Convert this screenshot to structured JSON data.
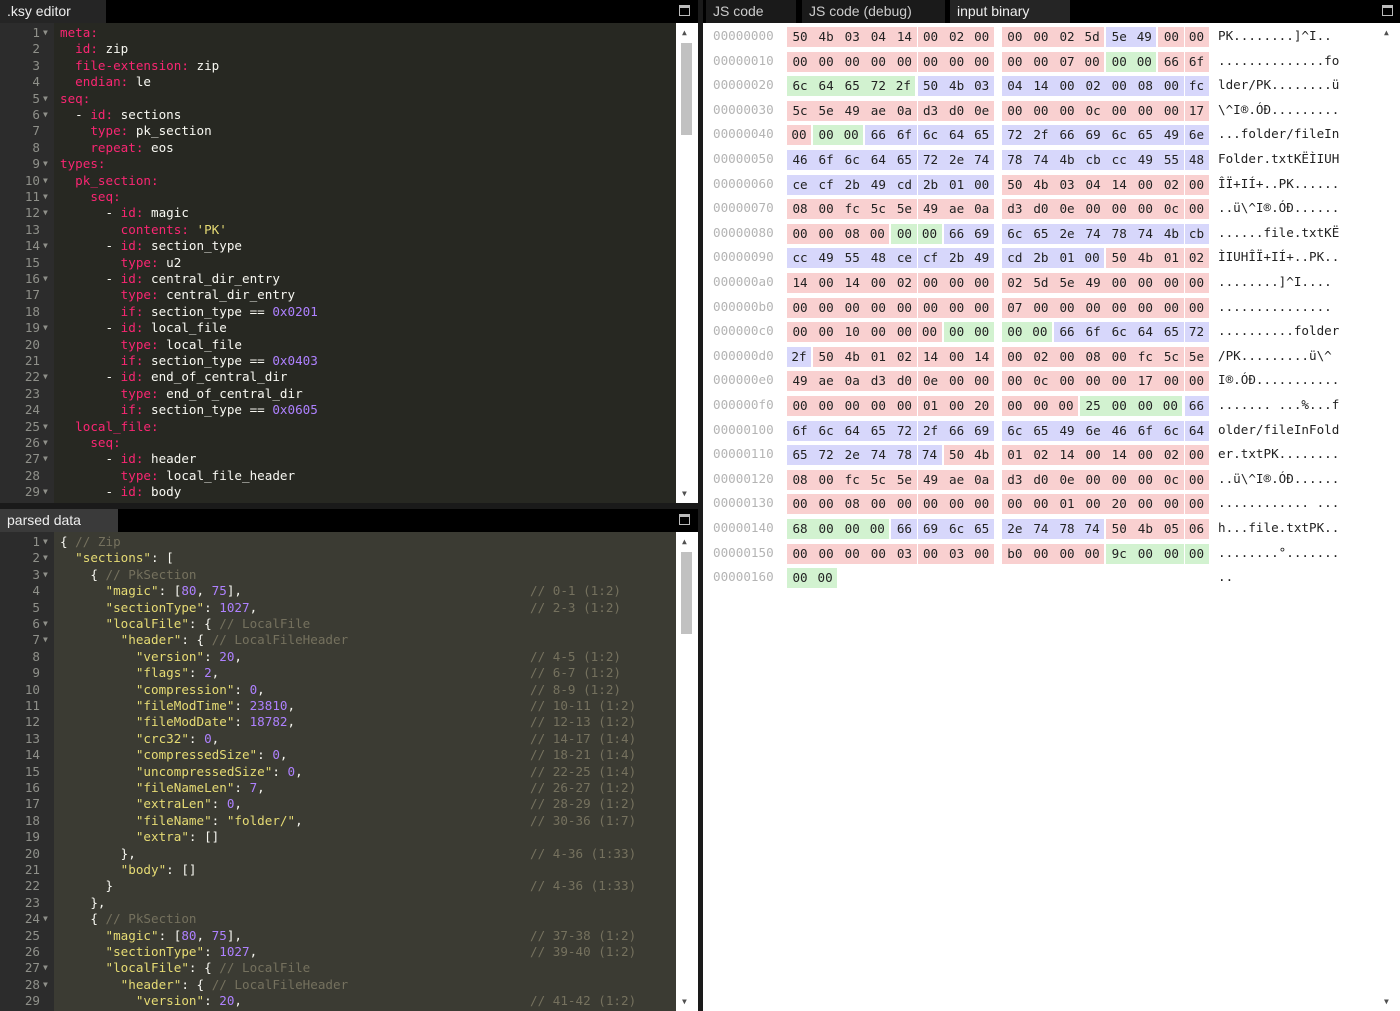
{
  "ksy_editor": {
    "tab_label": ".ksy editor",
    "lines": [
      [
        {
          "t": "meta:",
          "c": "k"
        }
      ],
      [
        {
          "t": "  "
        },
        {
          "t": "id:",
          "c": "k"
        },
        {
          "t": " zip"
        }
      ],
      [
        {
          "t": "  "
        },
        {
          "t": "file-extension:",
          "c": "k"
        },
        {
          "t": " zip"
        }
      ],
      [
        {
          "t": "  "
        },
        {
          "t": "endian:",
          "c": "k"
        },
        {
          "t": " le"
        }
      ],
      [
        {
          "t": "seq:",
          "c": "k"
        }
      ],
      [
        {
          "t": "  - "
        },
        {
          "t": "id:",
          "c": "k"
        },
        {
          "t": " sections"
        }
      ],
      [
        {
          "t": "    "
        },
        {
          "t": "type:",
          "c": "k"
        },
        {
          "t": " pk_section"
        }
      ],
      [
        {
          "t": "    "
        },
        {
          "t": "repeat:",
          "c": "k"
        },
        {
          "t": " eos"
        }
      ],
      [
        {
          "t": "types:",
          "c": "k"
        }
      ],
      [
        {
          "t": "  "
        },
        {
          "t": "pk_section:",
          "c": "k"
        }
      ],
      [
        {
          "t": "    "
        },
        {
          "t": "seq:",
          "c": "k"
        }
      ],
      [
        {
          "t": "      - "
        },
        {
          "t": "id:",
          "c": "k"
        },
        {
          "t": " magic"
        }
      ],
      [
        {
          "t": "        "
        },
        {
          "t": "contents:",
          "c": "k"
        },
        {
          "t": " 'PK'",
          "c": "s"
        }
      ],
      [
        {
          "t": "      - "
        },
        {
          "t": "id:",
          "c": "k"
        },
        {
          "t": " section_type"
        }
      ],
      [
        {
          "t": "        "
        },
        {
          "t": "type:",
          "c": "k"
        },
        {
          "t": " u2"
        }
      ],
      [
        {
          "t": "      - "
        },
        {
          "t": "id:",
          "c": "k"
        },
        {
          "t": " central_dir_entry"
        }
      ],
      [
        {
          "t": "        "
        },
        {
          "t": "type:",
          "c": "k"
        },
        {
          "t": " central_dir_entry"
        }
      ],
      [
        {
          "t": "        "
        },
        {
          "t": "if:",
          "c": "k"
        },
        {
          "t": " section_type == "
        },
        {
          "t": "0x0201",
          "c": "n"
        }
      ],
      [
        {
          "t": "      - "
        },
        {
          "t": "id:",
          "c": "k"
        },
        {
          "t": " local_file"
        }
      ],
      [
        {
          "t": "        "
        },
        {
          "t": "type:",
          "c": "k"
        },
        {
          "t": " local_file"
        }
      ],
      [
        {
          "t": "        "
        },
        {
          "t": "if:",
          "c": "k"
        },
        {
          "t": " section_type == "
        },
        {
          "t": "0x0403",
          "c": "n"
        }
      ],
      [
        {
          "t": "      - "
        },
        {
          "t": "id:",
          "c": "k"
        },
        {
          "t": " end_of_central_dir"
        }
      ],
      [
        {
          "t": "        "
        },
        {
          "t": "type:",
          "c": "k"
        },
        {
          "t": " end_of_central_dir"
        }
      ],
      [
        {
          "t": "        "
        },
        {
          "t": "if:",
          "c": "k"
        },
        {
          "t": " section_type == "
        },
        {
          "t": "0x0605",
          "c": "n"
        }
      ],
      [
        {
          "t": "  "
        },
        {
          "t": "local_file:",
          "c": "k"
        }
      ],
      [
        {
          "t": "    "
        },
        {
          "t": "seq:",
          "c": "k"
        }
      ],
      [
        {
          "t": "      - "
        },
        {
          "t": "id:",
          "c": "k"
        },
        {
          "t": " header"
        }
      ],
      [
        {
          "t": "        "
        },
        {
          "t": "type:",
          "c": "k"
        },
        {
          "t": " local_file_header"
        }
      ],
      [
        {
          "t": "      - "
        },
        {
          "t": "id:",
          "c": "k"
        },
        {
          "t": " body"
        }
      ]
    ],
    "fold_lines": [
      1,
      5,
      6,
      9,
      10,
      11,
      12,
      14,
      16,
      19,
      22,
      25,
      26,
      27,
      29
    ]
  },
  "parsed_data": {
    "tab_label": "parsed data",
    "lines": [
      [
        {
          "t": "{ "
        },
        {
          "t": "// Zip",
          "c": "c"
        }
      ],
      [
        {
          "t": "  "
        },
        {
          "t": "\"sections\"",
          "c": "s"
        },
        {
          "t": ": ["
        }
      ],
      [
        {
          "t": "    { "
        },
        {
          "t": "// PkSection",
          "c": "c"
        }
      ],
      [
        {
          "t": "      "
        },
        {
          "t": "\"magic\"",
          "c": "s"
        },
        {
          "t": ": ["
        },
        {
          "t": "80",
          "c": "n"
        },
        {
          "t": ", "
        },
        {
          "t": "75",
          "c": "n"
        },
        {
          "t": "],"
        }
      ],
      [
        {
          "t": "      "
        },
        {
          "t": "\"sectionType\"",
          "c": "s"
        },
        {
          "t": ": "
        },
        {
          "t": "1027",
          "c": "n"
        },
        {
          "t": ","
        }
      ],
      [
        {
          "t": "      "
        },
        {
          "t": "\"localFile\"",
          "c": "s"
        },
        {
          "t": ": { "
        },
        {
          "t": "// LocalFile",
          "c": "c"
        }
      ],
      [
        {
          "t": "        "
        },
        {
          "t": "\"header\"",
          "c": "s"
        },
        {
          "t": ": { "
        },
        {
          "t": "// LocalFileHeader",
          "c": "c"
        }
      ],
      [
        {
          "t": "          "
        },
        {
          "t": "\"version\"",
          "c": "s"
        },
        {
          "t": ": "
        },
        {
          "t": "20",
          "c": "n"
        },
        {
          "t": ","
        }
      ],
      [
        {
          "t": "          "
        },
        {
          "t": "\"flags\"",
          "c": "s"
        },
        {
          "t": ": "
        },
        {
          "t": "2",
          "c": "n"
        },
        {
          "t": ","
        }
      ],
      [
        {
          "t": "          "
        },
        {
          "t": "\"compression\"",
          "c": "s"
        },
        {
          "t": ": "
        },
        {
          "t": "0",
          "c": "n"
        },
        {
          "t": ","
        }
      ],
      [
        {
          "t": "          "
        },
        {
          "t": "\"fileModTime\"",
          "c": "s"
        },
        {
          "t": ": "
        },
        {
          "t": "23810",
          "c": "n"
        },
        {
          "t": ","
        }
      ],
      [
        {
          "t": "          "
        },
        {
          "t": "\"fileModDate\"",
          "c": "s"
        },
        {
          "t": ": "
        },
        {
          "t": "18782",
          "c": "n"
        },
        {
          "t": ","
        }
      ],
      [
        {
          "t": "          "
        },
        {
          "t": "\"crc32\"",
          "c": "s"
        },
        {
          "t": ": "
        },
        {
          "t": "0",
          "c": "n"
        },
        {
          "t": ","
        }
      ],
      [
        {
          "t": "          "
        },
        {
          "t": "\"compressedSize\"",
          "c": "s"
        },
        {
          "t": ": "
        },
        {
          "t": "0",
          "c": "n"
        },
        {
          "t": ","
        }
      ],
      [
        {
          "t": "          "
        },
        {
          "t": "\"uncompressedSize\"",
          "c": "s"
        },
        {
          "t": ": "
        },
        {
          "t": "0",
          "c": "n"
        },
        {
          "t": ","
        }
      ],
      [
        {
          "t": "          "
        },
        {
          "t": "\"fileNameLen\"",
          "c": "s"
        },
        {
          "t": ": "
        },
        {
          "t": "7",
          "c": "n"
        },
        {
          "t": ","
        }
      ],
      [
        {
          "t": "          "
        },
        {
          "t": "\"extraLen\"",
          "c": "s"
        },
        {
          "t": ": "
        },
        {
          "t": "0",
          "c": "n"
        },
        {
          "t": ","
        }
      ],
      [
        {
          "t": "          "
        },
        {
          "t": "\"fileName\"",
          "c": "s"
        },
        {
          "t": ": "
        },
        {
          "t": "\"folder/\"",
          "c": "s"
        },
        {
          "t": ","
        }
      ],
      [
        {
          "t": "          "
        },
        {
          "t": "\"extra\"",
          "c": "s"
        },
        {
          "t": ": []"
        }
      ],
      [
        {
          "t": "        },"
        }
      ],
      [
        {
          "t": "        "
        },
        {
          "t": "\"body\"",
          "c": "s"
        },
        {
          "t": ": []"
        }
      ],
      [
        {
          "t": "      }"
        }
      ],
      [
        {
          "t": "    },"
        }
      ],
      [
        {
          "t": "    { "
        },
        {
          "t": "// PkSection",
          "c": "c"
        }
      ],
      [
        {
          "t": "      "
        },
        {
          "t": "\"magic\"",
          "c": "s"
        },
        {
          "t": ": ["
        },
        {
          "t": "80",
          "c": "n"
        },
        {
          "t": ", "
        },
        {
          "t": "75",
          "c": "n"
        },
        {
          "t": "],"
        }
      ],
      [
        {
          "t": "      "
        },
        {
          "t": "\"sectionType\"",
          "c": "s"
        },
        {
          "t": ": "
        },
        {
          "t": "1027",
          "c": "n"
        },
        {
          "t": ","
        }
      ],
      [
        {
          "t": "      "
        },
        {
          "t": "\"localFile\"",
          "c": "s"
        },
        {
          "t": ": { "
        },
        {
          "t": "// LocalFile",
          "c": "c"
        }
      ],
      [
        {
          "t": "        "
        },
        {
          "t": "\"header\"",
          "c": "s"
        },
        {
          "t": ": { "
        },
        {
          "t": "// LocalFileHeader",
          "c": "c"
        }
      ],
      [
        {
          "t": "          "
        },
        {
          "t": "\"version\"",
          "c": "s"
        },
        {
          "t": ": "
        },
        {
          "t": "20",
          "c": "n"
        },
        {
          "t": ","
        }
      ]
    ],
    "comments": [
      "",
      "",
      "",
      "// 0-1 (1:2)",
      "// 2-3 (1:2)",
      "",
      "",
      "// 4-5 (1:2)",
      "// 6-7 (1:2)",
      "// 8-9 (1:2)",
      "// 10-11 (1:2)",
      "// 12-13 (1:2)",
      "// 14-17 (1:4)",
      "// 18-21 (1:4)",
      "// 22-25 (1:4)",
      "// 26-27 (1:2)",
      "// 28-29 (1:2)",
      "// 30-36 (1:7)",
      "",
      "// 4-36 (1:33)",
      "",
      "// 4-36 (1:33)",
      "",
      "",
      "// 37-38 (1:2)",
      "// 39-40 (1:2)",
      "",
      "",
      "// 41-42 (1:2)"
    ],
    "fold_lines": [
      1,
      2,
      3,
      6,
      7,
      24,
      27,
      28
    ]
  },
  "right_tabs": [
    "JS code",
    "JS code (debug)",
    "input binary"
  ],
  "hex_view": {
    "rows": [
      {
        "off": "00000000",
        "bytes": "50 4b 03 04 14 00 02 00 00 00 02 5d 5e 49 00 00",
        "cls": "rrrrrrrrrrrrbbrr",
        "ascii": "PK........]^I.."
      },
      {
        "off": "00000010",
        "bytes": "00 00 00 00 00 00 00 00 00 00 07 00 00 00 66 6f",
        "cls": "rrrrrrrrrrrrggrr",
        "ascii": "..............fo"
      },
      {
        "off": "00000020",
        "bytes": "6c 64 65 72 2f 50 4b 03 04 14 00 02 00 08 00 fc",
        "cls": "gggggbbbbbbbbbbb",
        "ascii": "lder/PK........ü"
      },
      {
        "off": "00000030",
        "bytes": "5c 5e 49 ae 0a d3 d0 0e 00 00 00 0c 00 00 00 17",
        "cls": "rrrrrrrrrrrrrrrr",
        "ascii": "\\^I®.ÓÐ........."
      },
      {
        "off": "00000040",
        "bytes": "00 00 00 66 6f 6c 64 65 72 2f 66 69 6c 65 49 6e",
        "cls": "rggbbbbbbbbbbbbb",
        "ascii": "...folder/fileIn"
      },
      {
        "off": "00000050",
        "bytes": "46 6f 6c 64 65 72 2e 74 78 74 4b cb cc 49 55 48",
        "cls": "bbbbbbbbbbbbbbbb",
        "ascii": "Folder.txtKËÌIUH"
      },
      {
        "off": "00000060",
        "bytes": "ce cf 2b 49 cd 2b 01 00 50 4b 03 04 14 00 02 00",
        "cls": "bbbbbbbbrrrrrrrr",
        "ascii": "ÎÏ+IÍ+..PK......"
      },
      {
        "off": "00000070",
        "bytes": "08 00 fc 5c 5e 49 ae 0a d3 d0 0e 00 00 00 0c 00",
        "cls": "rrrrrrrrrrrrrrrr",
        "ascii": "..ü\\^I®.ÓÐ......"
      },
      {
        "off": "00000080",
        "bytes": "00 00 08 00 00 00 66 69 6c 65 2e 74 78 74 4b cb",
        "cls": "rrrrggbbbbbbbbbb",
        "ascii": "......file.txtKË"
      },
      {
        "off": "00000090",
        "bytes": "cc 49 55 48 ce cf 2b 49 cd 2b 01 00 50 4b 01 02",
        "cls": "bbbbbbbbbbbbrrrr",
        "ascii": "ÌIUHÎÏ+IÍ+..PK.."
      },
      {
        "off": "000000a0",
        "bytes": "14 00 14 00 02 00 00 00 02 5d 5e 49 00 00 00 00",
        "cls": "rrrrrrrrrrrrrrrr",
        "ascii": "........]^I...."
      },
      {
        "off": "000000b0",
        "bytes": "00 00 00 00 00 00 00 00 07 00 00 00 00 00 00 00",
        "cls": "rrrrrrrrrrrrrrrr",
        "ascii": "..............."
      },
      {
        "off": "000000c0",
        "bytes": "00 00 10 00 00 00 00 00 00 00 66 6f 6c 64 65 72",
        "cls": "rrrrrrggggbbbbbb",
        "ascii": "..........folder"
      },
      {
        "off": "000000d0",
        "bytes": "2f 50 4b 01 02 14 00 14 00 02 00 08 00 fc 5c 5e",
        "cls": "brrrrrrrrrrrrrrr",
        "ascii": "/PK.........ü\\^"
      },
      {
        "off": "000000e0",
        "bytes": "49 ae 0a d3 d0 0e 00 00 00 0c 00 00 00 17 00 00",
        "cls": "rrrrrrrrrrrrrrrr",
        "ascii": "I®.ÓÐ..........."
      },
      {
        "off": "000000f0",
        "bytes": "00 00 00 00 00 01 00 20 00 00 00 25 00 00 00 66",
        "cls": "rrrrrrrrrrrggggb",
        "ascii": "....... ...%...f"
      },
      {
        "off": "00000100",
        "bytes": "6f 6c 64 65 72 2f 66 69 6c 65 49 6e 46 6f 6c 64",
        "cls": "bbbbbbbbbbbbbbbb",
        "ascii": "older/fileInFold"
      },
      {
        "off": "00000110",
        "bytes": "65 72 2e 74 78 74 50 4b 01 02 14 00 14 00 02 00",
        "cls": "bbbbbbrrrrrrrrrr",
        "ascii": "er.txtPK........"
      },
      {
        "off": "00000120",
        "bytes": "08 00 fc 5c 5e 49 ae 0a d3 d0 0e 00 00 00 0c 00",
        "cls": "rrrrrrrrrrrrrrrr",
        "ascii": "..ü\\^I®.ÓÐ......"
      },
      {
        "off": "00000130",
        "bytes": "00 00 08 00 00 00 00 00 00 00 01 00 20 00 00 00",
        "cls": "rrrrrrrrrrrrrrrr",
        "ascii": "............ ..."
      },
      {
        "off": "00000140",
        "bytes": "68 00 00 00 66 69 6c 65 2e 74 78 74 50 4b 05 06",
        "cls": "ggggbbbbbbbbrrrr",
        "ascii": "h...file.txtPK.."
      },
      {
        "off": "00000150",
        "bytes": "00 00 00 00 03 00 03 00 b0 00 00 00 9c 00 00 00",
        "cls": "rrrrrrrrrrrrgggg",
        "ascii": "........°......."
      },
      {
        "off": "00000160",
        "bytes": "00 00",
        "cls": "gg",
        "ascii": ".."
      }
    ]
  }
}
